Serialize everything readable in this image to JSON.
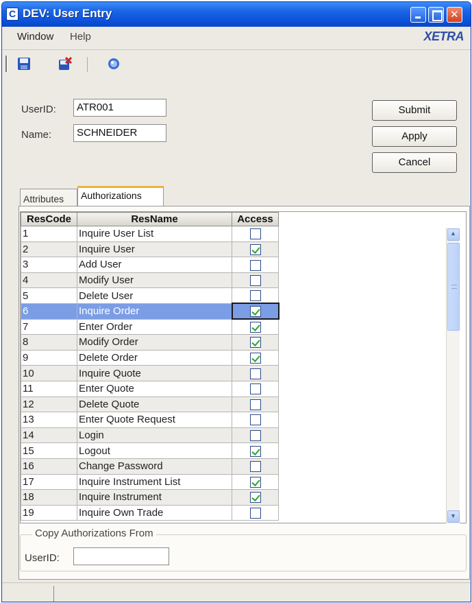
{
  "window": {
    "title": "DEV: User Entry"
  },
  "menu": {
    "window": "Window",
    "help": "Help"
  },
  "logo": "XETRA",
  "toolbar": {
    "icons": [
      "save-icon",
      "save-all-icon",
      "about-icon"
    ]
  },
  "form": {
    "userid_label": "UserID:",
    "userid_value": "ATR001",
    "name_label": "Name:",
    "name_value": "SCHNEIDER"
  },
  "buttons": {
    "submit": "Submit",
    "apply": "Apply",
    "cancel": "Cancel"
  },
  "tabs": {
    "attributes": "Attributes",
    "authorizations": "Authorizations",
    "active": "Authorizations"
  },
  "grid": {
    "columns": [
      "ResCode",
      "ResName",
      "Access"
    ],
    "selected_row": 6,
    "rows": [
      {
        "code": "1",
        "name": "Inquire User List",
        "access": false
      },
      {
        "code": "2",
        "name": "Inquire User",
        "access": true
      },
      {
        "code": "3",
        "name": "Add User",
        "access": false
      },
      {
        "code": "4",
        "name": "Modify User",
        "access": false
      },
      {
        "code": "5",
        "name": "Delete User",
        "access": false
      },
      {
        "code": "6",
        "name": "Inquire Order",
        "access": true
      },
      {
        "code": "7",
        "name": "Enter Order",
        "access": true
      },
      {
        "code": "8",
        "name": "Modify Order",
        "access": true
      },
      {
        "code": "9",
        "name": "Delete Order",
        "access": true
      },
      {
        "code": "10",
        "name": "Inquire Quote",
        "access": false
      },
      {
        "code": "11",
        "name": "Enter Quote",
        "access": false
      },
      {
        "code": "12",
        "name": "Delete Quote",
        "access": false
      },
      {
        "code": "13",
        "name": "Enter Quote Request",
        "access": false
      },
      {
        "code": "14",
        "name": "Login",
        "access": false
      },
      {
        "code": "15",
        "name": "Logout",
        "access": true
      },
      {
        "code": "16",
        "name": "Change Password",
        "access": false
      },
      {
        "code": "17",
        "name": "Inquire Instrument List",
        "access": true
      },
      {
        "code": "18",
        "name": "Inquire Instrument",
        "access": true
      },
      {
        "code": "19",
        "name": "Inquire Own Trade",
        "access": false
      }
    ]
  },
  "copy_group": {
    "title": "Copy Authorizations From",
    "userid_label": "UserID:",
    "userid_value": ""
  }
}
